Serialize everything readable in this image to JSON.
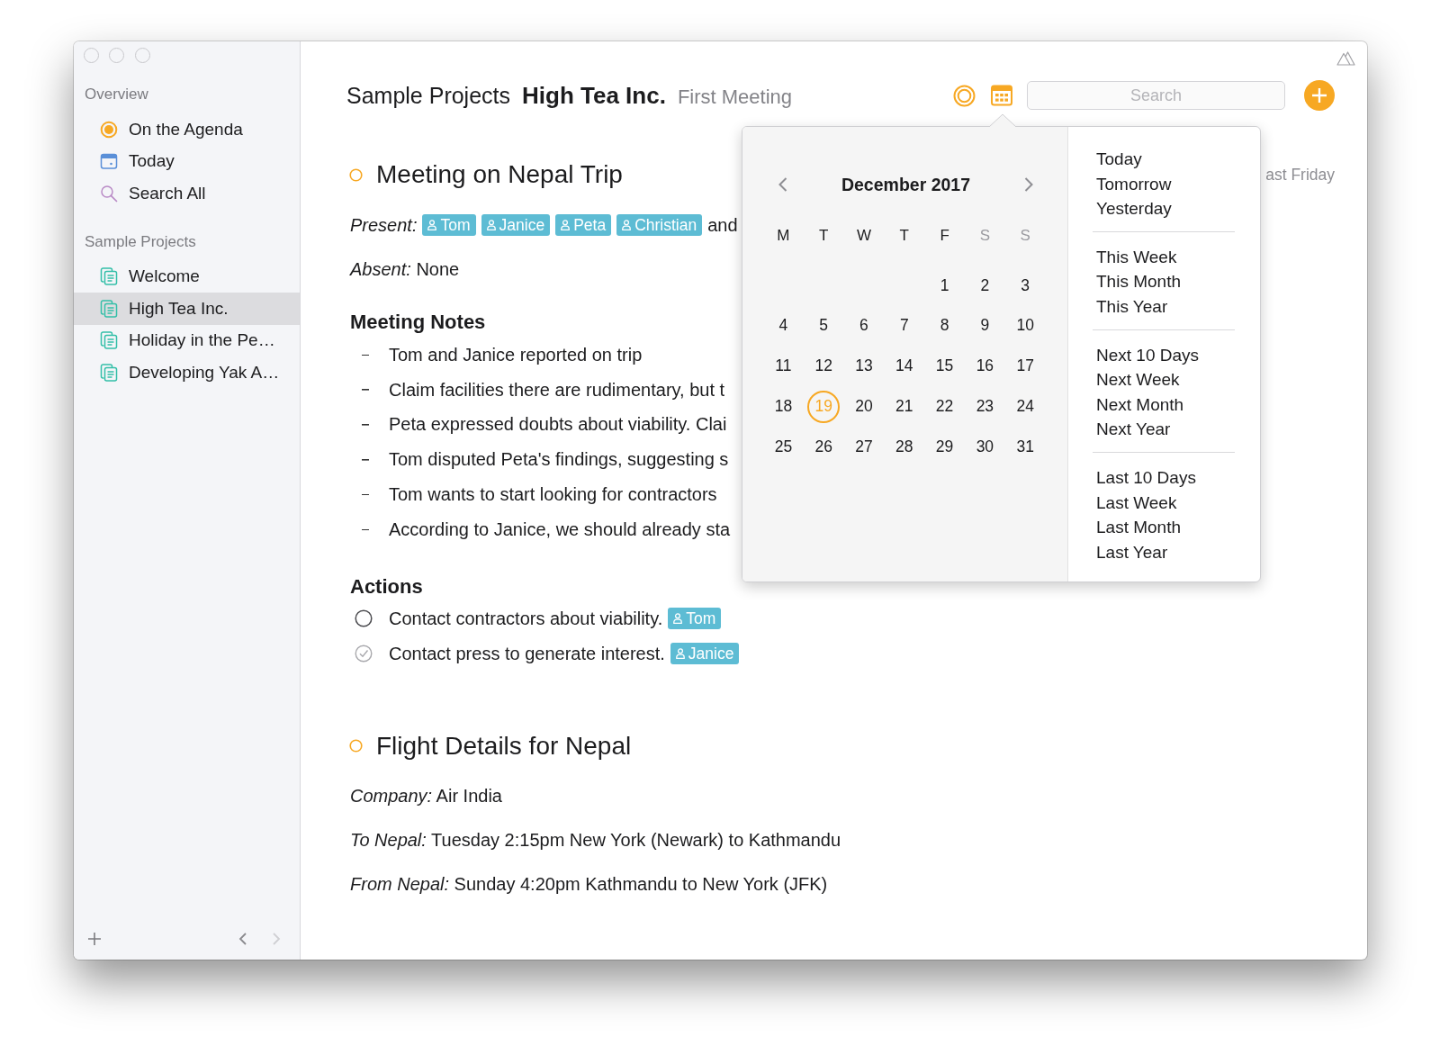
{
  "sidebar": {
    "sections": [
      {
        "title": "Overview",
        "items": [
          {
            "label": "On the Agenda",
            "kind": "agenda",
            "selected": false
          },
          {
            "label": "Today",
            "kind": "today",
            "selected": false
          },
          {
            "label": "Search All",
            "kind": "search",
            "selected": false
          }
        ]
      },
      {
        "title": "Sample Projects",
        "items": [
          {
            "label": "Welcome",
            "kind": "project",
            "selected": false
          },
          {
            "label": "High Tea Inc.",
            "kind": "project",
            "selected": true
          },
          {
            "label": "Holiday in the Pe…",
            "kind": "project",
            "selected": false
          },
          {
            "label": "Developing Yak A…",
            "kind": "project",
            "selected": false
          }
        ]
      }
    ],
    "footer": {
      "back": {
        "disabled": false
      },
      "forward": {
        "disabled": true
      }
    }
  },
  "header": {
    "project": "Sample Projects",
    "title": "High Tea Inc.",
    "subtitle": "First Meeting"
  },
  "toolbar": {
    "search": {
      "placeholder": "Search"
    }
  },
  "date_picker": {
    "month": "December 2017",
    "weekdays": [
      {
        "label": "M",
        "weekend": false
      },
      {
        "label": "T",
        "weekend": false
      },
      {
        "label": "W",
        "weekend": false
      },
      {
        "label": "T",
        "weekend": false
      },
      {
        "label": "F",
        "weekend": false
      },
      {
        "label": "S",
        "weekend": true
      },
      {
        "label": "S",
        "weekend": true
      }
    ],
    "weeks": [
      {
        "right_aligned": true,
        "days": [
          {
            "label": "1",
            "selected": false
          },
          {
            "label": "2",
            "selected": false
          },
          {
            "label": "3",
            "selected": false
          }
        ]
      },
      {
        "days": [
          {
            "label": "4",
            "selected": false
          },
          {
            "label": "5",
            "selected": false
          },
          {
            "label": "6",
            "selected": false
          },
          {
            "label": "7",
            "selected": false
          },
          {
            "label": "8",
            "selected": false
          },
          {
            "label": "9",
            "selected": false
          },
          {
            "label": "10",
            "selected": false
          }
        ]
      },
      {
        "days": [
          {
            "label": "11",
            "selected": false
          },
          {
            "label": "12",
            "selected": false
          },
          {
            "label": "13",
            "selected": false
          },
          {
            "label": "14",
            "selected": false
          },
          {
            "label": "15",
            "selected": false
          },
          {
            "label": "16",
            "selected": false
          },
          {
            "label": "17",
            "selected": false
          }
        ]
      },
      {
        "days": [
          {
            "label": "18",
            "selected": false
          },
          {
            "label": "19",
            "selected": true
          },
          {
            "label": "20",
            "selected": false
          },
          {
            "label": "21",
            "selected": false
          },
          {
            "label": "22",
            "selected": false
          },
          {
            "label": "23",
            "selected": false
          },
          {
            "label": "24",
            "selected": false
          }
        ]
      },
      {
        "days": [
          {
            "label": "25",
            "selected": false
          },
          {
            "label": "26",
            "selected": false
          },
          {
            "label": "27",
            "selected": false
          },
          {
            "label": "28",
            "selected": false
          },
          {
            "label": "29",
            "selected": false
          },
          {
            "label": "30",
            "selected": false
          },
          {
            "label": "31",
            "selected": false
          }
        ]
      }
    ],
    "shortcut_groups": [
      {
        "items": [
          "Today",
          "Tomorrow",
          "Yesterday"
        ]
      },
      {
        "items": [
          "This Week",
          "This Month",
          "This Year"
        ]
      },
      {
        "items": [
          "Next 10 Days",
          "Next Week",
          "Next Month",
          "Next Year"
        ]
      },
      {
        "items": [
          "Last 10 Days",
          "Last Week",
          "Last Month",
          "Last Year"
        ]
      }
    ]
  },
  "tasks": [
    {
      "title": "Meeting on Nepal Trip",
      "date": "ast Friday",
      "blocks": [
        {
          "kind": "attendees",
          "label": "Present:",
          "tags": [
            "Tom",
            "Janice",
            "Peta",
            "Christian"
          ],
          "trailing": "and"
        },
        {
          "kind": "field",
          "text": "*Absent:* None"
        },
        {
          "kind": "heading",
          "text": "Meeting Notes"
        },
        {
          "kind": "bullets",
          "items": [
            "Tom and Janice reported on trip",
            "Claim facilities there are rudimentary, but t",
            "Peta expressed doubts about viability. Clai",
            "Tom disputed Peta's findings, suggesting s",
            "Tom wants to start looking for contractors",
            "According to Janice, we should already sta"
          ]
        },
        {
          "kind": "heading",
          "text": "Actions"
        },
        {
          "kind": "actions",
          "items": [
            {
              "text": "Contact contractors about viability.",
              "checked": false,
              "tags": [
                "Tom"
              ]
            },
            {
              "text": "Contact press to generate interest.",
              "checked": true,
              "tags": [
                "Janice"
              ]
            }
          ]
        }
      ]
    },
    {
      "title": "Flight Details for Nepal",
      "blocks": [
        {
          "kind": "field",
          "text": "*Company:* Air India"
        },
        {
          "kind": "field",
          "text": "*To Nepal:* Tuesday 2:15pm New York (Newark) to Kathmandu"
        },
        {
          "kind": "field",
          "text": "*From Nepal:* Sunday 4:20pm Kathmandu to New York (JFK)"
        }
      ]
    }
  ]
}
